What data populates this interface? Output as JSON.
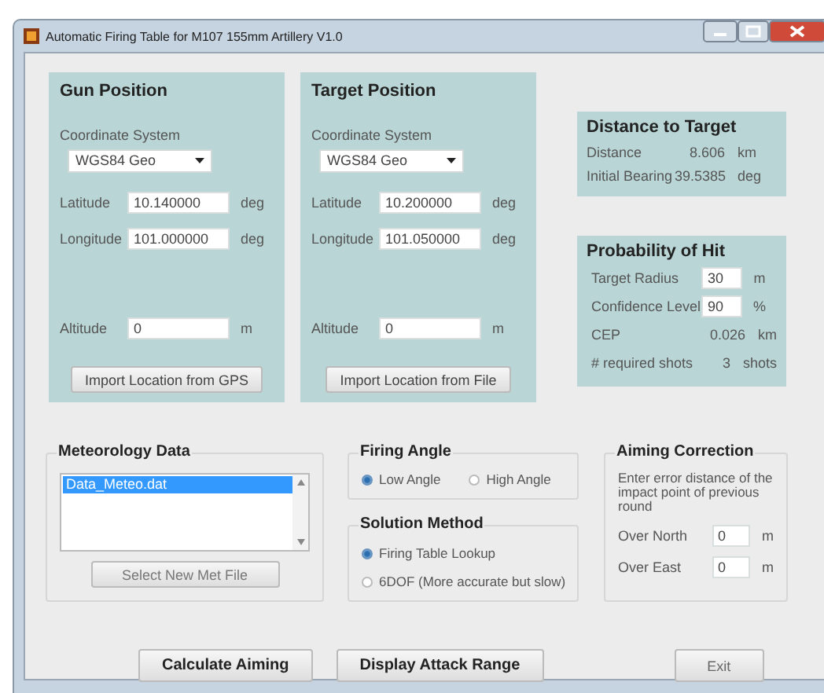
{
  "window": {
    "title": "Automatic Firing Table for M107 155mm Artillery V1.0"
  },
  "positions": [
    {
      "title": "Gun Position",
      "coordinate_label": "Coordinate System",
      "coordinate_system": "WGS84 Geo",
      "fields": [
        {
          "label": "Latitude",
          "value": "10.140000",
          "unit": "deg"
        },
        {
          "label": "Longitude",
          "value": "101.000000",
          "unit": "deg"
        },
        {
          "label": "Altitude",
          "value": "0",
          "unit": "m"
        }
      ],
      "button": "Import Location from GPS"
    },
    {
      "title": "Target Position",
      "coordinate_label": "Coordinate System",
      "coordinate_system": "WGS84 Geo",
      "fields": [
        {
          "label": "Latitude",
          "value": "10.200000",
          "unit": "deg"
        },
        {
          "label": "Longitude",
          "value": "101.050000",
          "unit": "deg"
        },
        {
          "label": "Altitude",
          "value": "0",
          "unit": "m"
        }
      ],
      "button": "Import Location from File"
    }
  ],
  "distance_to_target": {
    "title": "Distance to Target",
    "rows": [
      {
        "label": "Distance",
        "value": "8.606",
        "unit": "km"
      },
      {
        "label": "Initial Bearing",
        "value": "39.5385",
        "unit": "deg"
      }
    ]
  },
  "probability_of_hit": {
    "title": "Probability of Hit",
    "rows": [
      {
        "kind": "input",
        "label": "Target Radius",
        "value": "30",
        "unit": "m"
      },
      {
        "kind": "input",
        "label": "Confidence Level",
        "value": "90",
        "unit": "%"
      },
      {
        "kind": "output",
        "label": "CEP",
        "value": "0.026",
        "unit": "km"
      },
      {
        "kind": "output",
        "label": "# required shots",
        "value": "3",
        "unit": "shots"
      }
    ]
  },
  "meteorology_data": {
    "title": "Meteorology Data",
    "files": [
      {
        "label": "Data_Meteo.dat",
        "selected": true
      }
    ],
    "button": "Select New Met File"
  },
  "firing_angle": {
    "title": "Firing Angle",
    "options": [
      {
        "label": "Low Angle",
        "selected": true
      },
      {
        "label": "High Angle",
        "selected": false
      }
    ]
  },
  "solution_method": {
    "title": "Solution Method",
    "options": [
      {
        "label": "Firing Table Lookup",
        "selected": true
      },
      {
        "label": "6DOF (More accurate but slow)",
        "selected": false
      }
    ]
  },
  "aiming_correction": {
    "title": "Aiming Correction",
    "description": "Enter error distance of the impact point of previous round",
    "fields": [
      {
        "label": "Over North",
        "value": "0",
        "unit": "m"
      },
      {
        "label": "Over East",
        "value": "0",
        "unit": "m"
      }
    ]
  },
  "buttons": [
    {
      "label": "Calculate Aiming",
      "kind": "primary"
    },
    {
      "label": "Display Attack Range",
      "kind": "primary"
    },
    {
      "label": "Exit",
      "kind": "plain"
    }
  ]
}
